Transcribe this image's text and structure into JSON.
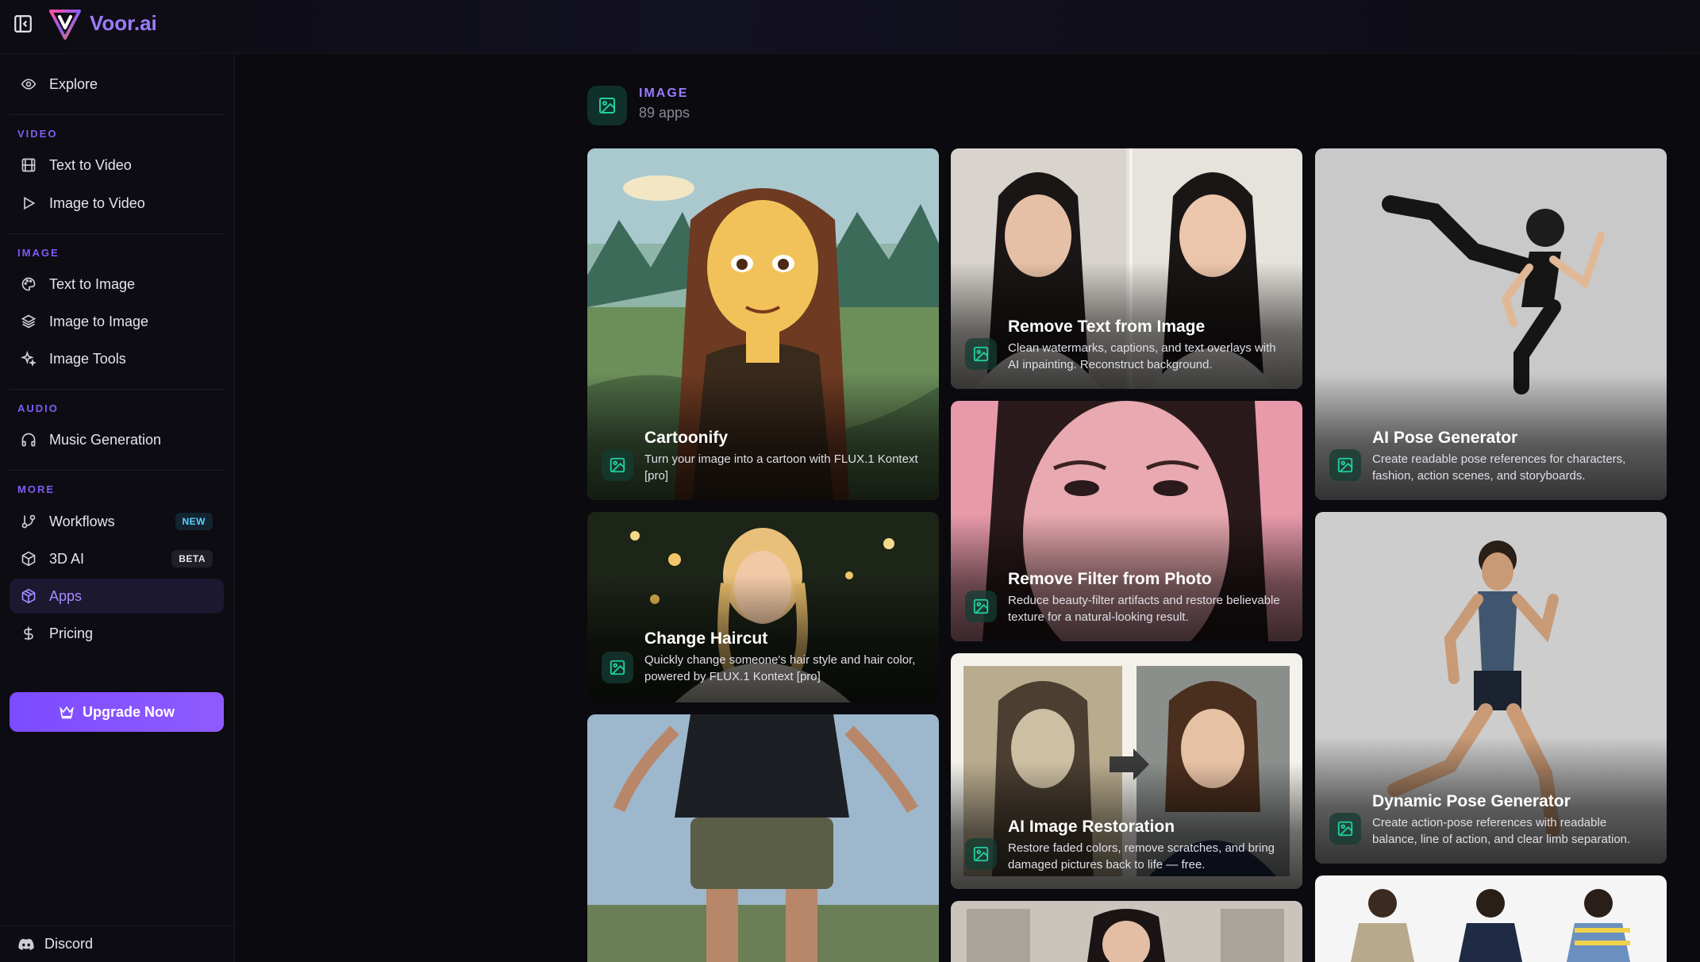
{
  "app": {
    "brand": "Voor.ai"
  },
  "sidebar": {
    "explore": "Explore",
    "sections": {
      "video": "VIDEO",
      "image": "IMAGE",
      "audio": "AUDIO",
      "more": "MORE"
    },
    "items": {
      "text_to_video": "Text to Video",
      "image_to_video": "Image to Video",
      "text_to_image": "Text to Image",
      "image_to_image": "Image to Image",
      "image_tools": "Image Tools",
      "music_generation": "Music Generation",
      "workflows": "Workflows",
      "ai_3d": "3D AI",
      "apps": "Apps",
      "pricing": "Pricing"
    },
    "badges": {
      "workflows": "NEW",
      "ai_3d": "BETA"
    },
    "upgrade": "Upgrade Now",
    "discord": "Discord"
  },
  "category": {
    "title": "IMAGE",
    "count": "89 apps"
  },
  "cards": {
    "cartoonify": {
      "title": "Cartoonify",
      "desc": "Turn your image into a cartoon with FLUX.1 Kontext [pro]"
    },
    "remove_text": {
      "title": "Remove Text from Image",
      "desc": "Clean watermarks, captions, and text overlays with AI inpainting. Reconstruct background."
    },
    "pose": {
      "title": "AI Pose Generator",
      "desc": "Create readable pose references for characters, fashion, action scenes, and storyboards."
    },
    "haircut": {
      "title": "Change Haircut",
      "desc": "Quickly change someone's hair style and hair color, powered by FLUX.1 Kontext [pro]"
    },
    "remove_filter": {
      "title": "Remove Filter from Photo",
      "desc": "Reduce beauty-filter artifacts and restore believable texture for a natural-looking result."
    },
    "restoration": {
      "title": "AI Image Restoration",
      "desc": "Restore faded colors, remove scratches, and bring damaged pictures back to life — free."
    },
    "dynamic_pose": {
      "title": "Dynamic Pose Generator",
      "desc": "Create action-pose references with readable balance, line of action, and clear limb separation."
    }
  },
  "colors": {
    "accent": "#8b5cf6",
    "brand": "#9b7bff",
    "category_icon": "#1fd1a0"
  }
}
